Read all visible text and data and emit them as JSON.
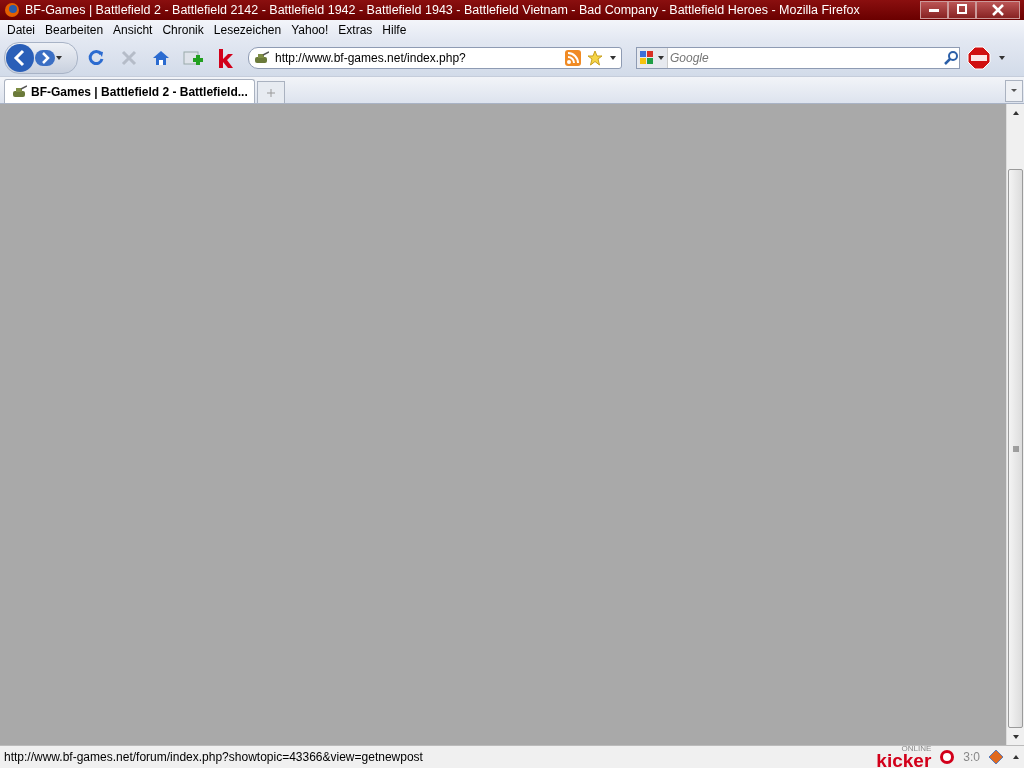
{
  "window": {
    "title": "BF-Games | Battlefield 2 - Battlefield 2142 - Battlefield 1942 - Battlefield 1943 - Battlefield Vietnam - Bad Company - Battlefield Heroes - Mozilla Firefox"
  },
  "menu": [
    "Datei",
    "Bearbeiten",
    "Ansicht",
    "Chronik",
    "Lesezeichen",
    "Yahoo!",
    "Extras",
    "Hilfe"
  ],
  "address_bar": {
    "value": "http://www.bf-games.net/index.php?"
  },
  "search": {
    "placeholder": "Google"
  },
  "tabs": [
    {
      "label": "BF-Games | Battlefield 2 - Battlefield...",
      "selected": true
    }
  ],
  "status_bar": {
    "text": "http://www.bf-games.net/forum/index.php?showtopic=43366&view=getnewpost",
    "kicker_logo": "kicker",
    "kicker_sub": "ONLINE",
    "score": "3:0"
  }
}
